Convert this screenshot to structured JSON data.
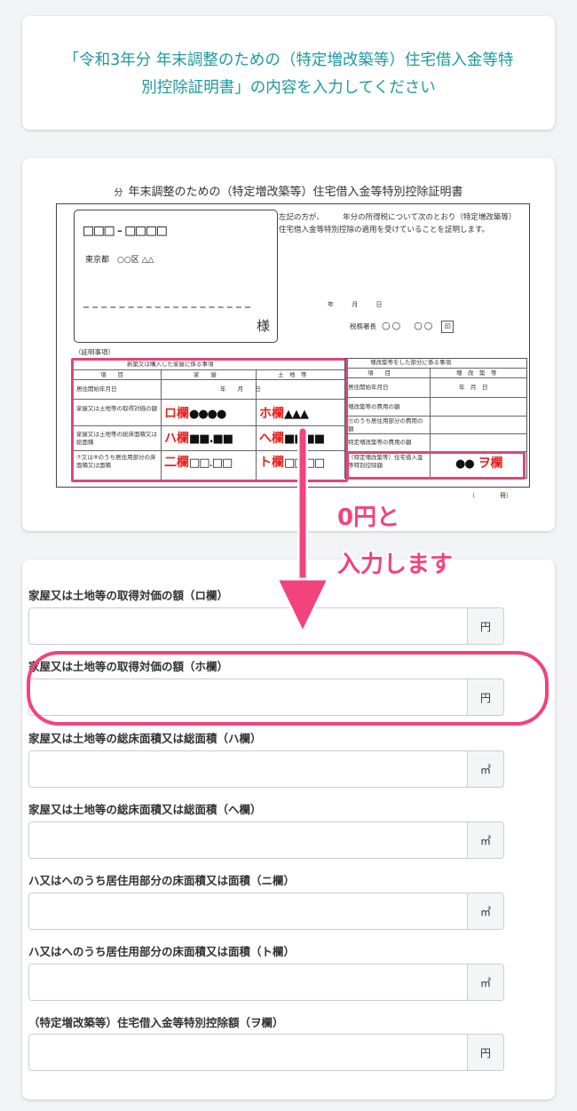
{
  "header": {
    "title": "「令和3年分 年末調整のための（特定増改築等）住宅借入金等特別控除証明書」の内容を入力してください"
  },
  "certificate": {
    "title_prefix": "分",
    "title": "年末調整のための（特定増改築等）住宅借入金等特別控除証明書",
    "postal": "□□□-□□□□",
    "city": "東京都　○○区 △△",
    "sama": "様",
    "desc": "左記の方が、　　　年分の所得税について次のとおり（特定増改築等）住宅借入金等特別控除の適用を受けていることを証明します。",
    "date": "年 月 日",
    "tax_office": "税務署長",
    "tax_circles": "○○　○○",
    "stamp": "印",
    "section": "（証明事項）",
    "left_header": "新築又は購入した家屋に係る事項",
    "col_item": "項　　目",
    "col_house": "家　　屋",
    "col_land": "土　地　等",
    "row1": "居住開始年月日",
    "row1_val": "年　　月　　日",
    "row2": "家屋又は土地等の取得対価の額",
    "row3": "家屋又は土地等の総床面積又は総面積",
    "row4": "⑦又は⑨のうち居住用部分の床面積又は面積",
    "right_header": "増改築等をした部分に係る事項",
    "r_col_item": "項　　目",
    "r_col_val": "増　改　築　等",
    "r_row1": "居住開始年月日",
    "r_row1_val": "年　月　日",
    "r_row2": "増改築等の費用の額",
    "r_row3": "⑪のうち居住用部分の費用の額",
    "r_row4": "特定増改築等の費用の額",
    "r_row5": "（特定増改築等）住宅借入金等特別控除額",
    "unit_yen": "円",
    "unit_m2": "㎡",
    "mark_ro": "ロ欄",
    "mark_ro_val": "●●●●",
    "mark_ho": "ホ欄",
    "mark_ho_val": "▲▲▲",
    "mark_ha": "ハ欄",
    "mark_ha_val": "■■.■■",
    "mark_he": "へ欄",
    "mark_he_val": "■■■■",
    "mark_ni": "二欄",
    "mark_ni_val": "□□.□□",
    "mark_to": "ト欄",
    "mark_to_val": "□□□□",
    "mark_wo": "ヲ欄",
    "mark_wo_val": "●●",
    "foot": "（　　　　冊）"
  },
  "callout": {
    "line1": "0円と",
    "line2": "入力します"
  },
  "form": {
    "fields": [
      {
        "label": "家屋又は土地等の取得対価の額（ロ欄）",
        "value": "",
        "unit": "円"
      },
      {
        "label": "家屋又は土地等の取得対価の額（ホ欄）",
        "value": "",
        "unit": "円"
      },
      {
        "label": "家屋又は土地等の総床面積又は総面積（ハ欄）",
        "value": "",
        "unit": "㎡"
      },
      {
        "label": "家屋又は土地等の総床面積又は総面積（へ欄）",
        "value": "",
        "unit": "㎡"
      },
      {
        "label": "ハ又はへのうち居住用部分の床面積又は面積（ニ欄）",
        "value": "",
        "unit": "㎡"
      },
      {
        "label": "ハ又はへのうち居住用部分の床面積又は面積（ト欄）",
        "value": "",
        "unit": "㎡"
      },
      {
        "label": "（特定増改築等）住宅借入金等特別控除額（ヲ欄）",
        "value": "",
        "unit": "円"
      }
    ]
  },
  "colors": {
    "accent": "#1d9aa0",
    "highlight": "#f2437c",
    "mark_red": "#e8231f"
  }
}
